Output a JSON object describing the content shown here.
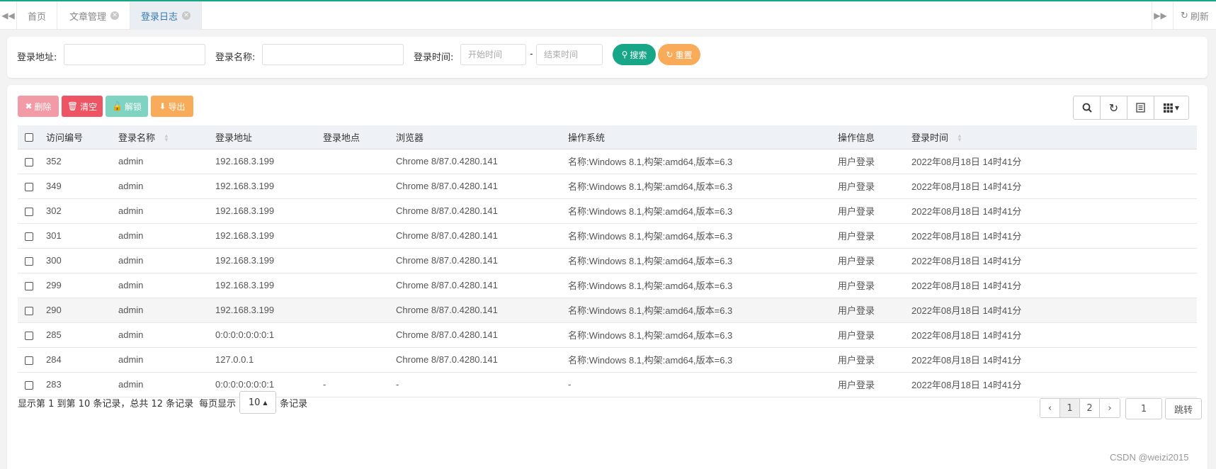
{
  "tabs": {
    "items": [
      {
        "label": "首页",
        "closable": false
      },
      {
        "label": "文章管理",
        "closable": true
      },
      {
        "label": "登录日志",
        "closable": true
      }
    ],
    "refresh_label": "刷新"
  },
  "search": {
    "addr_label": "登录地址:",
    "name_label": "登录名称:",
    "time_label": "登录时间:",
    "start_placeholder": "开始时间",
    "end_placeholder": "结束时间",
    "time_separator": "-",
    "search_button": "搜索",
    "reset_button": "重置"
  },
  "toolbar": {
    "delete": "删除",
    "clear": "清空",
    "unlock": "解锁",
    "export": "导出"
  },
  "table": {
    "headers": [
      "访问编号",
      "登录名称",
      "登录地址",
      "登录地点",
      "浏览器",
      "操作系统",
      "操作信息",
      "登录时间"
    ],
    "rows": [
      [
        "352",
        "admin",
        "192.168.3.199",
        "",
        "Chrome 8/87.0.4280.141",
        "名称:Windows 8.1,构架:amd64,版本=6.3",
        "用户登录",
        "2022年08月18日 14时41分"
      ],
      [
        "349",
        "admin",
        "192.168.3.199",
        "",
        "Chrome 8/87.0.4280.141",
        "名称:Windows 8.1,构架:amd64,版本=6.3",
        "用户登录",
        "2022年08月18日 14时41分"
      ],
      [
        "302",
        "admin",
        "192.168.3.199",
        "",
        "Chrome 8/87.0.4280.141",
        "名称:Windows 8.1,构架:amd64,版本=6.3",
        "用户登录",
        "2022年08月18日 14时41分"
      ],
      [
        "301",
        "admin",
        "192.168.3.199",
        "",
        "Chrome 8/87.0.4280.141",
        "名称:Windows 8.1,构架:amd64,版本=6.3",
        "用户登录",
        "2022年08月18日 14时41分"
      ],
      [
        "300",
        "admin",
        "192.168.3.199",
        "",
        "Chrome 8/87.0.4280.141",
        "名称:Windows 8.1,构架:amd64,版本=6.3",
        "用户登录",
        "2022年08月18日 14时41分"
      ],
      [
        "299",
        "admin",
        "192.168.3.199",
        "",
        "Chrome 8/87.0.4280.141",
        "名称:Windows 8.1,构架:amd64,版本=6.3",
        "用户登录",
        "2022年08月18日 14时41分"
      ],
      [
        "290",
        "admin",
        "192.168.3.199",
        "",
        "Chrome 8/87.0.4280.141",
        "名称:Windows 8.1,构架:amd64,版本=6.3",
        "用户登录",
        "2022年08月18日 14时41分"
      ],
      [
        "285",
        "admin",
        "0:0:0:0:0:0:0:1",
        "",
        "Chrome 8/87.0.4280.141",
        "名称:Windows 8.1,构架:amd64,版本=6.3",
        "用户登录",
        "2022年08月18日 14时41分"
      ],
      [
        "284",
        "admin",
        "127.0.0.1",
        "",
        "Chrome 8/87.0.4280.141",
        "名称:Windows 8.1,构架:amd64,版本=6.3",
        "用户登录",
        "2022年08月18日 14时41分"
      ],
      [
        "283",
        "admin",
        "0:0:0:0:0:0:0:1",
        "-",
        "-",
        "-",
        "用户登录",
        "2022年08月18日 14时41分"
      ]
    ],
    "highlighted_row": 6
  },
  "pagination": {
    "info": "显示第 1 到第 10 条记录，总共 12 条记录",
    "per_page_label": "每页显示",
    "page_size": "10",
    "records_suffix": "条记录",
    "prev": "‹",
    "pages": [
      "1",
      "2"
    ],
    "current_page": "1",
    "next": "›",
    "jump_value": "1",
    "jump_label": "跳转"
  },
  "watermark": "CSDN @weizi2015",
  "colors": {
    "accent_green": "#18a689",
    "orange": "#f8ac59",
    "red": "#ed5565",
    "link_blue": "#337ab7"
  }
}
